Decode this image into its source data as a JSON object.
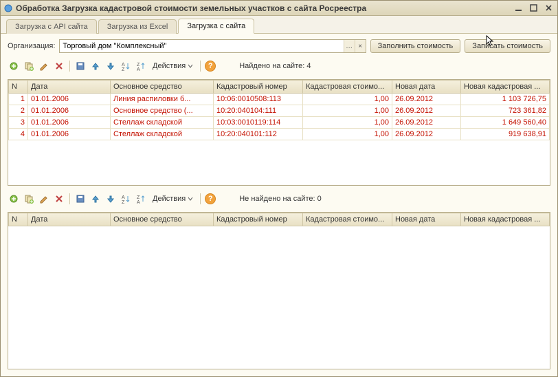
{
  "window": {
    "title": "Обработка  Загрузка кадастровой стоимости земельных участков с сайта Росреестра"
  },
  "tabs": [
    {
      "label": "Загрузка с API сайта",
      "active": false
    },
    {
      "label": "Загрузка из Excel",
      "active": false
    },
    {
      "label": "Загрузка с сайта",
      "active": true
    }
  ],
  "org": {
    "label": "Организация:",
    "value": "Торговый дом \"Комплексный\""
  },
  "buttons": {
    "fill": "Заполнить стоимость",
    "write": "Записать стоимость",
    "actions": "Действия"
  },
  "found": {
    "label_top": "Найдено на сайте: 4",
    "label_bottom": "Не найдено на сайте: 0"
  },
  "columns": [
    "N",
    "Дата",
    "Основное средство",
    "Кадастровый номер",
    "Кадастровая стоимо...",
    "Новая дата",
    "Новая кадастровая ..."
  ],
  "rows_top": [
    {
      "n": "1",
      "date": "01.01.2006",
      "asset": "Линия распиловки б...",
      "cad": "10:06:0010508:113",
      "cost": "1,00",
      "newdate": "26.09.2012",
      "newcost": "1 103 726,75"
    },
    {
      "n": "2",
      "date": "01.01.2006",
      "asset": "Основное средство (...",
      "cad": "10:20:040104:111",
      "cost": "1,00",
      "newdate": "26.09.2012",
      "newcost": "723 361,82"
    },
    {
      "n": "3",
      "date": "01.01.2006",
      "asset": "Стеллаж складской",
      "cad": "10:03:0010119:114",
      "cost": "1,00",
      "newdate": "26.09.2012",
      "newcost": "1 649 560,40"
    },
    {
      "n": "4",
      "date": "01.01.2006",
      "asset": "Стеллаж складской",
      "cad": "10:20:040101:112",
      "cost": "1,00",
      "newdate": "26.09.2012",
      "newcost": "919 638,91"
    }
  ],
  "rows_bottom": []
}
